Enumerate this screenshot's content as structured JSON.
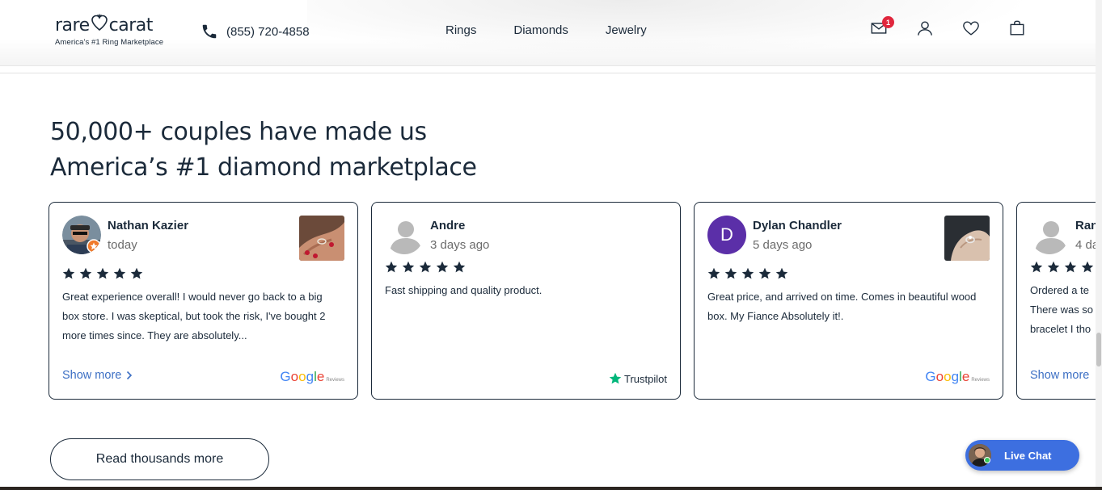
{
  "header": {
    "logo_word_left": "rare",
    "logo_word_right": "carat",
    "logo_tagline": "America's #1 Ring Marketplace",
    "phone": "(855) 720-4858",
    "nav": [
      "Rings",
      "Diamonds",
      "Jewelry"
    ],
    "mail_badge": "1",
    "icons": [
      "mail-icon",
      "user-icon",
      "heart-icon",
      "bag-icon"
    ]
  },
  "heading": {
    "line1": "50,000+ couples have made us",
    "line2": "America’s #1 diamond marketplace"
  },
  "reviews": [
    {
      "name": "Nathan Kazier",
      "when": "today",
      "rating": 5,
      "text": "Great experience overall! I would never go back to a big box store. I was skeptical, but took the risk, I've bought 2 more times since. They are absolutely...",
      "show_more": "Show more",
      "source": "Google",
      "source_sub": "Reviews"
    },
    {
      "name": "Andre",
      "when": "3 days ago",
      "rating": 5,
      "text": "Fast shipping and quality product.",
      "source": "Trustpilot"
    },
    {
      "name": "Dylan Chandler",
      "initial": "D",
      "when": "5 days ago",
      "rating": 5,
      "text": "Great price, and arrived on time. Comes in beautiful wood box. My Fiance Absolutely it!.",
      "source": "Google",
      "source_sub": "Reviews"
    },
    {
      "name": "Ran",
      "when": "4 da",
      "rating": 5,
      "text": "Ordered a te There was so bracelet I tho",
      "text_lines": [
        "Ordered a te",
        "There was so",
        "bracelet I tho"
      ],
      "show_more": "Show more"
    }
  ],
  "read_more_label": "Read thousands more",
  "live_chat_label": "Live Chat",
  "colors": {
    "navy": "#1b2a3a",
    "link": "#3c6fc4",
    "chat": "#3d6fe0",
    "badge": "#e0263c",
    "dylan_avatar": "#5b2fa8"
  }
}
